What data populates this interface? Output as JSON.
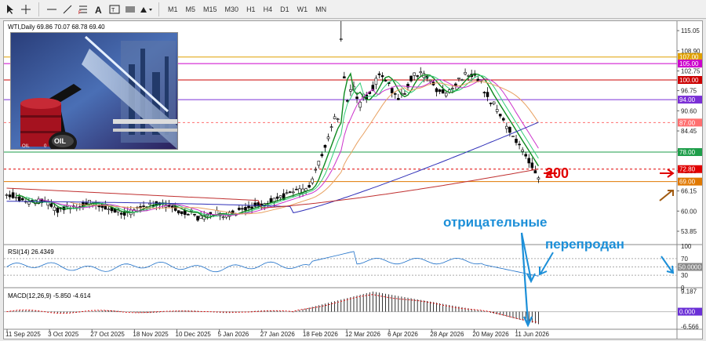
{
  "toolbar": {
    "tools": [
      "cursor-icon",
      "crosshair-icon",
      "hline-icon",
      "trendline-icon",
      "fib-icon",
      "text-icon",
      "label-icon",
      "rect-icon",
      "shapes-icon"
    ],
    "timeframes": [
      "M1",
      "M5",
      "M15",
      "M30",
      "H1",
      "H4",
      "D1",
      "W1",
      "MN"
    ]
  },
  "chart": {
    "symbol_info": "WTI,Daily  69.86 70.07 68.78 69.40",
    "rsi_label": "RSI(14) 26.4349",
    "macd_label": "MACD(12,26,9) -5.850 -4.614",
    "price_ticks": [
      "115.05",
      "108.90",
      "102.75",
      "96.75",
      "90.60",
      "84.45",
      "78.30",
      "72.30",
      "66.15",
      "60.00",
      "53.85"
    ],
    "level_labels": [
      {
        "text": "107.00",
        "color": "#e0a000"
      },
      {
        "text": "105.00",
        "color": "#cc00cc"
      },
      {
        "text": "100.00",
        "color": "#cc0000"
      },
      {
        "text": "94.00",
        "color": "#7a2fd6"
      },
      {
        "text": "87.00",
        "color": "#ff6f6f"
      },
      {
        "text": "78.00",
        "color": "#1e9e4a"
      },
      {
        "text": "72.80",
        "color": "#e00000"
      },
      {
        "text": "69.00",
        "color": "#e07800"
      }
    ],
    "rsi_ticks": [
      "100",
      "70",
      "50",
      "30",
      "0"
    ],
    "rsi_value_label": "50.0000",
    "macd_ticks": [
      "9.187",
      "0.000",
      "-6.566"
    ],
    "date_labels": [
      "11 Sep 2025",
      "3 Oct 2025",
      "27 Oct 2025",
      "18 Nov 2025",
      "10 Dec 2025",
      "5 Jan 2026",
      "27 Jan 2026",
      "18 Feb 2026",
      "12 Mar 2026",
      "6 Apr 2026",
      "28 Apr 2026",
      "20 May 2026",
      "11 Jun 2026"
    ]
  },
  "annotations": {
    "ma200": "200",
    "negative": "отрицательные",
    "oversold": "перепродан"
  },
  "image": {
    "barrel_text": "OIL",
    "small_text_1": "OIL",
    "small_text_2": "0"
  },
  "colors": {
    "background": "#ffffff",
    "candle": "#000000",
    "ma_short": "#0d8a1f",
    "ma_fast": "#33cc77",
    "ma_mid": "#cc33cc",
    "ma_slow": "#e8a060",
    "ma_100": "#2f2fb8",
    "ma_200": "#c03030",
    "annotation_blue": "#1c8fd8",
    "annotation_red": "#e00000"
  }
}
